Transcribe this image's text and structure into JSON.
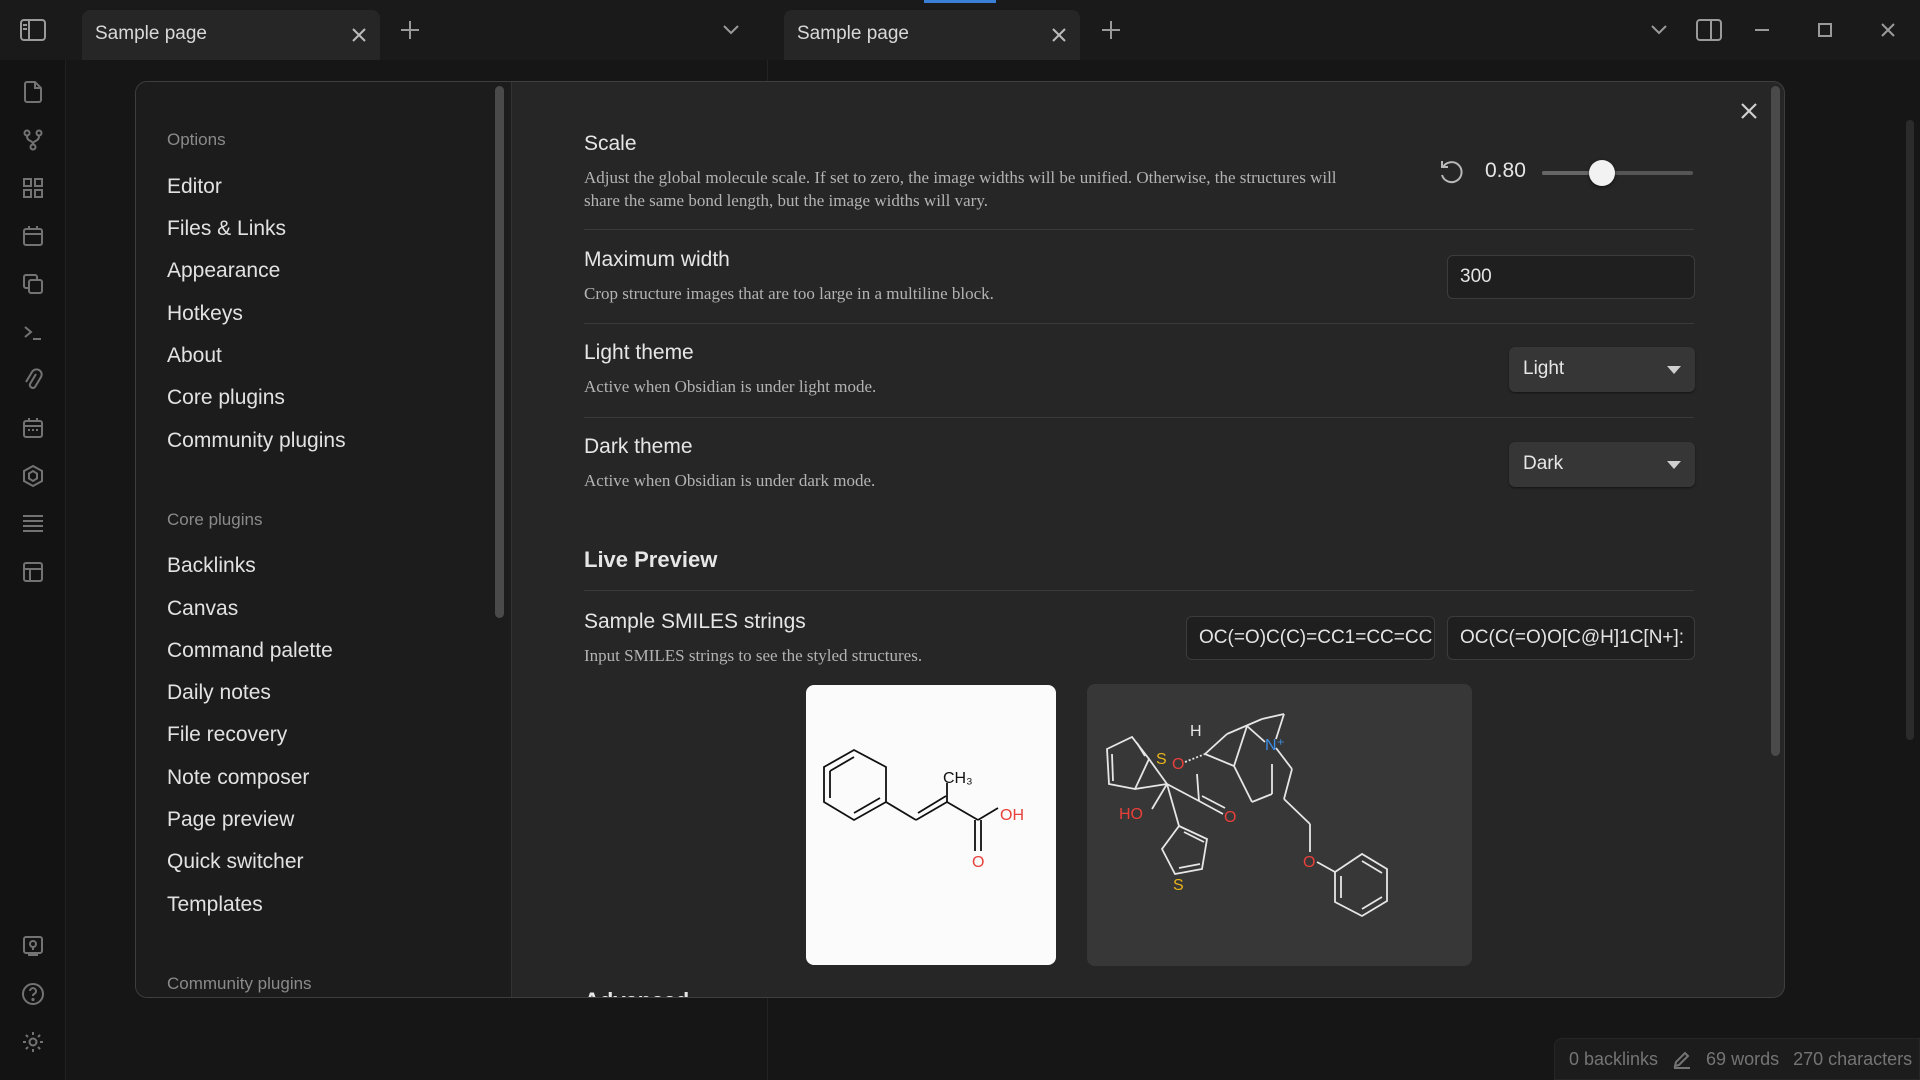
{
  "tabs": [
    {
      "title": "Sample page"
    },
    {
      "title": "Sample page"
    }
  ],
  "status_bar": {
    "backlinks": "0 backlinks",
    "words": "69 words",
    "characters": "270 characters"
  },
  "sidebar": {
    "options_header": "Options",
    "options": [
      "Editor",
      "Files & Links",
      "Appearance",
      "Hotkeys",
      "About",
      "Core plugins",
      "Community plugins"
    ],
    "core_header": "Core plugins",
    "core": [
      "Backlinks",
      "Canvas",
      "Command palette",
      "Daily notes",
      "File recovery",
      "Note composer",
      "Page preview",
      "Quick switcher",
      "Templates"
    ],
    "community_header": "Community plugins"
  },
  "settings": {
    "scale": {
      "name": "Scale",
      "desc": "Adjust the global molecule scale. If set to zero, the image widths will be unified. Otherwise, the structures will share the same bond length, but the image widths will vary.",
      "value": "0.80",
      "slider_fraction": 0.4
    },
    "max_width": {
      "name": "Maximum width",
      "desc": "Crop structure images that are too large in a multiline block.",
      "value": "300"
    },
    "light_theme": {
      "name": "Light theme",
      "desc": "Active when Obsidian is under light mode.",
      "value": "Light"
    },
    "dark_theme": {
      "name": "Dark theme",
      "desc": "Active when Obsidian is under dark mode.",
      "value": "Dark"
    },
    "live_preview_header": "Live Preview",
    "samples": {
      "name": "Sample SMILES strings",
      "desc": "Input SMILES strings to see the styled structures.",
      "smiles_1": "OC(=O)C(C)=CC1=CC=CC",
      "smiles_2": "OC(C(=O)O[C@H]1C[N+]:"
    },
    "advanced_header": "Advanced"
  },
  "molecule_1": {
    "labels": {
      "ch3": "CH₃",
      "oh": "OH",
      "o": "O"
    }
  },
  "molecule_2": {
    "labels": {
      "h": "H",
      "n": "N⁺",
      "o1": "O",
      "o2": "O",
      "ho": "HO",
      "s1": "S",
      "s2": "S",
      "o3": "O"
    }
  },
  "colors": {
    "accent": "#3a7fd6",
    "oxygen": "#e8403a",
    "sulfur": "#e8b41b",
    "nitrogen": "#3f8ee6"
  }
}
